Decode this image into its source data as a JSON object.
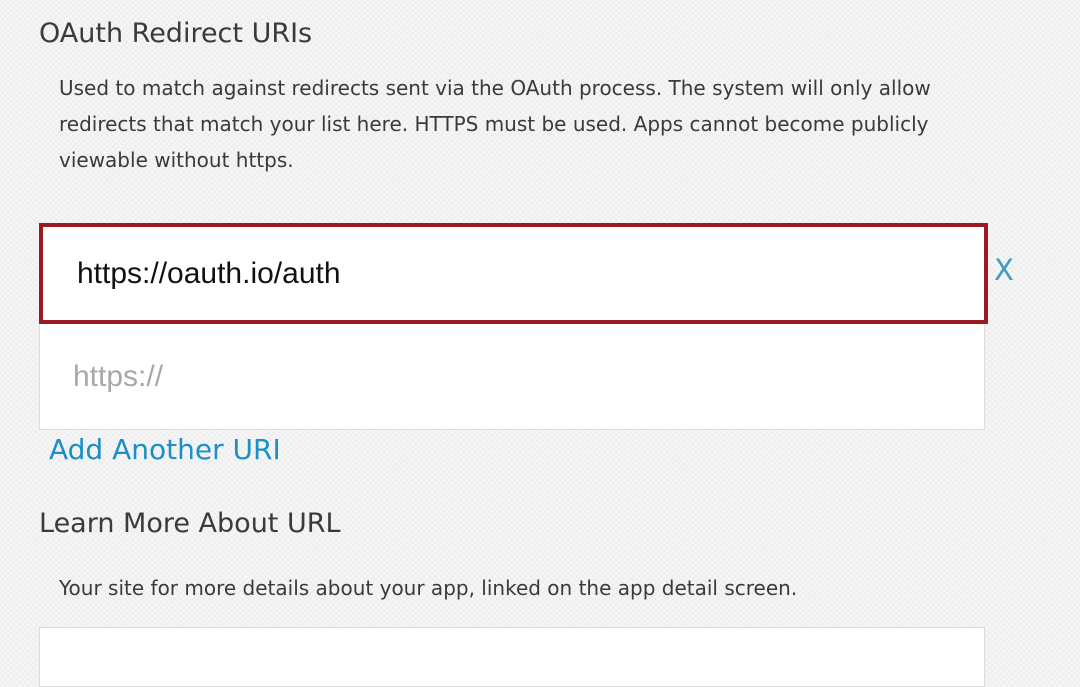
{
  "oauth_section": {
    "title": "OAuth Redirect URIs",
    "description": "Used to match against redirects sent via the OAuth process. The system will only allow redirects that match your list here.  HTTPS must be used. Apps cannot become publicly viewable without https.",
    "uris": [
      {
        "value": "https://oauth.io/auth",
        "placeholder": ""
      },
      {
        "value": "",
        "placeholder": "https://"
      }
    ],
    "remove_label": "X",
    "add_label": "Add Another URI"
  },
  "learn_section": {
    "title": "Learn More About URL",
    "description": "Your site for more details about your app, linked on the app detail screen.",
    "url_value": ""
  },
  "colors": {
    "focus_border": "#9a1a22",
    "link": "#1a8fc9",
    "remove_x": "#3d9cc4",
    "placeholder": "#a8a8a8"
  }
}
